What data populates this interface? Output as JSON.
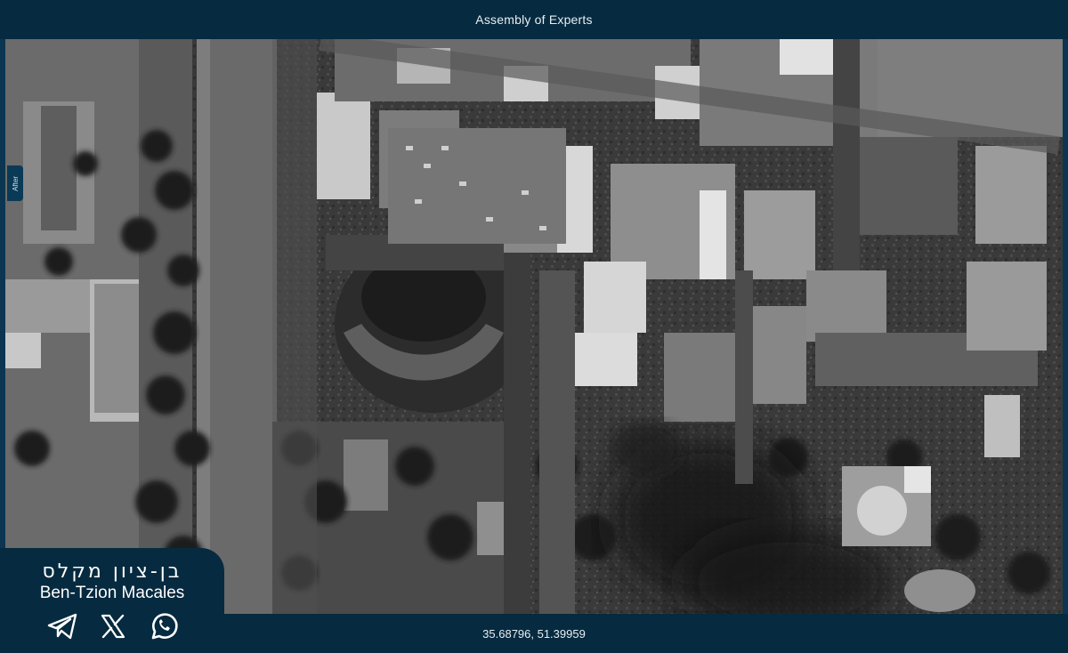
{
  "header": {
    "title": "Assembly of Experts"
  },
  "view": {
    "label": "After"
  },
  "footer": {
    "coordinates": "35.68796, 51.39959"
  },
  "credit": {
    "name_hebrew": "בן-ציון מקלס",
    "name_english": "Ben-Tzion Macales",
    "icons": [
      "telegram-icon",
      "x-icon",
      "whatsapp-icon"
    ]
  },
  "colors": {
    "bar": "#062a3f",
    "text": "#e6eef3"
  }
}
